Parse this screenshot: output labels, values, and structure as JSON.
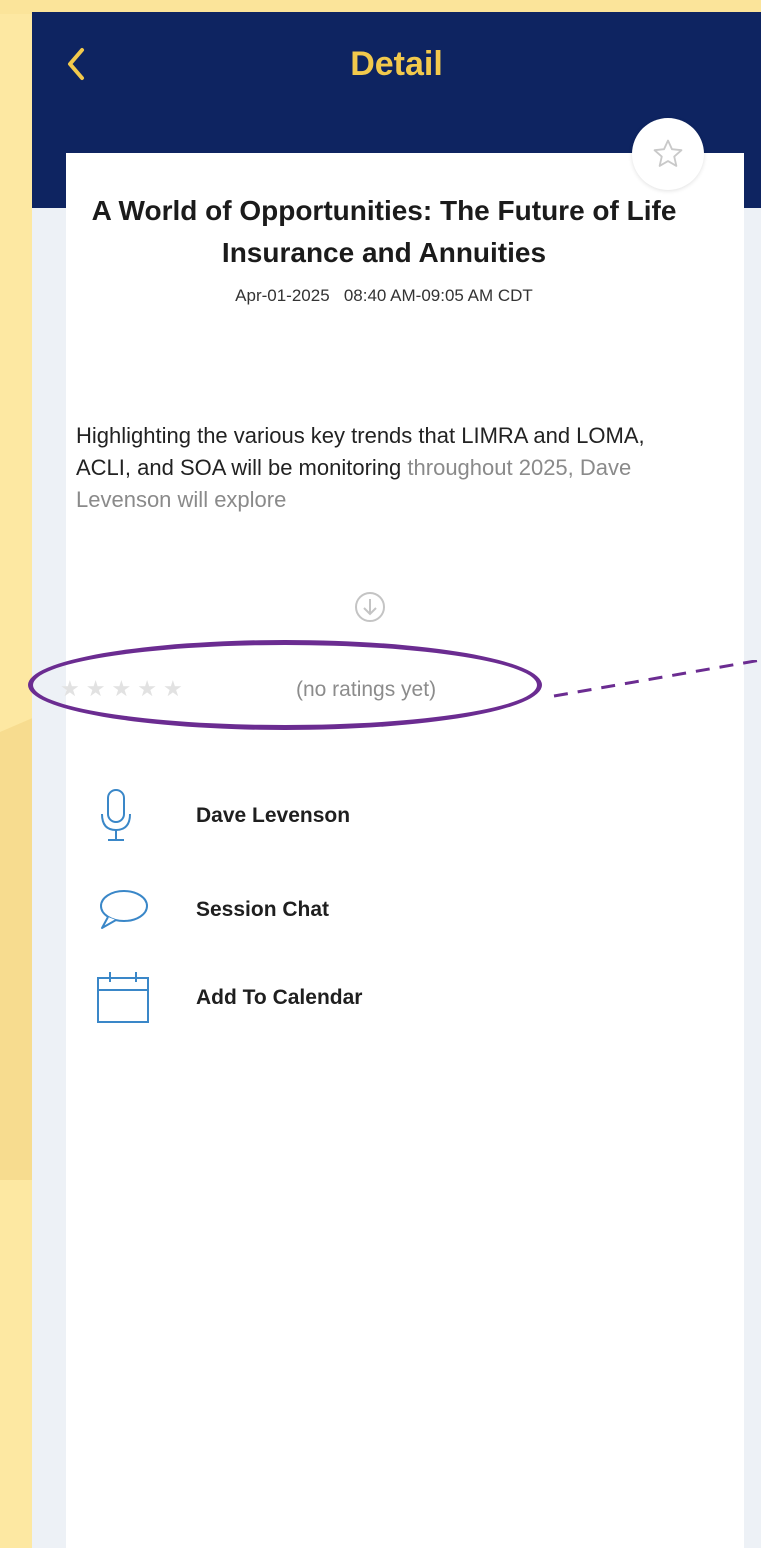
{
  "header": {
    "back_icon": "chevron-left-icon",
    "title": "Detail"
  },
  "session": {
    "favorite_icon": "star-outline-icon",
    "title": "A World of Opportunities: The Future of Life Insurance and Annuities",
    "date": "Apr-01-2025",
    "time": "08:40 AM-09:05 AM CDT",
    "description_visible": "Highlighting the various key trends that LIMRA and LOMA, ACLI, and SOA will be monitoring",
    "description_faded": "throughout 2025, Dave Levenson will explore",
    "expand_icon": "circle-arrow-down-icon"
  },
  "rating": {
    "stars_filled": 0,
    "stars_total": 5,
    "text": "(no ratings yet)"
  },
  "actions": [
    {
      "icon": "microphone-icon",
      "label": "Dave Levenson"
    },
    {
      "icon": "chat-bubble-icon",
      "label": "Session Chat"
    },
    {
      "icon": "calendar-icon",
      "label": "Add To Calendar"
    }
  ],
  "colors": {
    "nav_background": "#0e2461",
    "accent": "#f2c94c",
    "highlight_oval": "#6b2c91",
    "icon_blue": "#3a87c8",
    "page_background": "#fde8a2"
  }
}
